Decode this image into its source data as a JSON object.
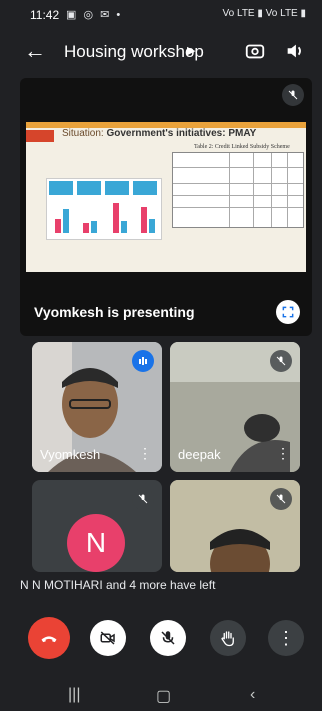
{
  "status_bar": {
    "time": "11:42",
    "left_icons": "▣ ◎ ✉ •",
    "right_icons": "Vo LTE ▮ Vo LTE ▮"
  },
  "meeting": {
    "title": "Housing workshop",
    "presenting_label": "Vyomkesh is presenting",
    "left_banner": "N N MOTIHARI and 4 more have left"
  },
  "slide": {
    "title_prefix": "Situation:",
    "title_main": "Government's initiatives: PMAY",
    "table_title": "Table 2: Credit Linked Subsidy Scheme"
  },
  "participants": [
    {
      "name": "Vyomkesh",
      "speaking": true
    },
    {
      "name": "deepak",
      "muted": true
    },
    {
      "name": "N N MOTIHARI",
      "initial": "N",
      "muted": true,
      "avatar_color": "#e8406b"
    },
    {
      "name": "",
      "muted": true
    }
  ],
  "colors": {
    "end_call": "#ea4335",
    "speaking": "#1a73e8",
    "background": "#202124"
  }
}
